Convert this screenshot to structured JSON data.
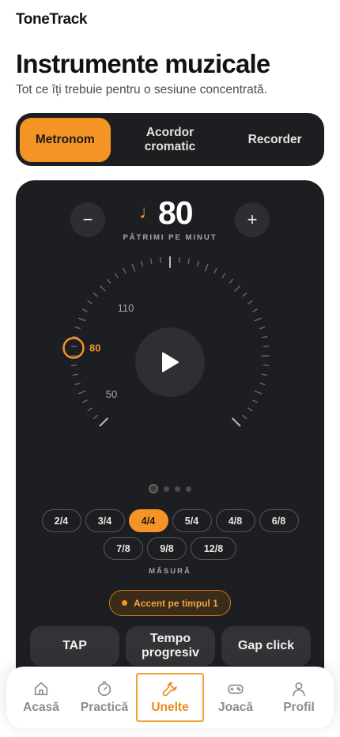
{
  "app": {
    "brand": "ToneTrack"
  },
  "header": {
    "title": "Instrumente muzicale",
    "subtitle": "Tot ce îți trebuie pentru o sesiune concentrată."
  },
  "modes": [
    {
      "label": "Metronom",
      "active": true
    },
    {
      "label": "Acordor cromatic",
      "active": false
    },
    {
      "label": "Recorder",
      "active": false
    }
  ],
  "metronome": {
    "bpm": "80",
    "bpm_unit": "PĂTRIMI PE MINUT",
    "minus_label": "−",
    "plus_label": "+",
    "dial": {
      "label_110": "110",
      "label_80": "80",
      "label_50": "50",
      "current": 80
    },
    "pager": {
      "count": 4,
      "active_index": 0
    },
    "meters": [
      "2/4",
      "3/4",
      "4/4",
      "5/4",
      "4/8",
      "6/8",
      "7/8",
      "9/8",
      "12/8"
    ],
    "selected_meter": "4/4",
    "meter_label": "MĂSURĂ",
    "accent_label": "Accent pe timpul 1",
    "tools": [
      "TAP",
      "Tempo progresiv",
      "Gap click"
    ]
  },
  "tabs": [
    {
      "label": "Acasă",
      "icon": "home-icon",
      "active": false
    },
    {
      "label": "Practică",
      "icon": "timer-icon",
      "active": false
    },
    {
      "label": "Unelte",
      "icon": "wrench-icon",
      "active": true
    },
    {
      "label": "Joacă",
      "icon": "gamepad-icon",
      "active": false
    },
    {
      "label": "Profil",
      "icon": "person-icon",
      "active": false
    }
  ],
  "colors": {
    "accent": "#f59426",
    "card": "#1d1e21",
    "background": "#ffffff"
  }
}
